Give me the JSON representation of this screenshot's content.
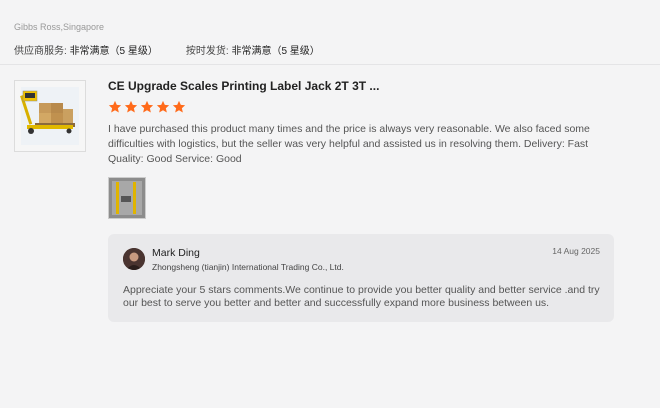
{
  "reviewer": {
    "location": "Gibbs Ross,Singapore"
  },
  "ratings": {
    "supplier_service_label": "供应商服务:",
    "supplier_service_value": "非常满意（5 星级）",
    "ontime_shipping_label": "按时发货:",
    "ontime_shipping_value": "非常满意（5 星级）"
  },
  "product": {
    "thumbnail_icon": "pallet-jack-product-image",
    "title": "CE Upgrade Scales Printing Label Jack 2T 3T ..."
  },
  "review": {
    "stars": 5,
    "star_color": "#ff6a1a",
    "text": "I have purchased this product many times and the price is always very reasonable. We also faced some difficulties with logistics, but the seller was very helpful and assisted us in resolving them. Delivery:  Fast Quality:  Good Service:  Good",
    "photo_icon": "review-photo-image"
  },
  "reply": {
    "name": "Mark Ding",
    "company": "Zhongsheng (tianjin) International Trading Co., Ltd.",
    "date": "14 Aug 2025",
    "text": "Appreciate your 5 stars comments.We continue to provide you better quality and better service .and try  our best to serve you better and better and successfully expand more business between us."
  }
}
